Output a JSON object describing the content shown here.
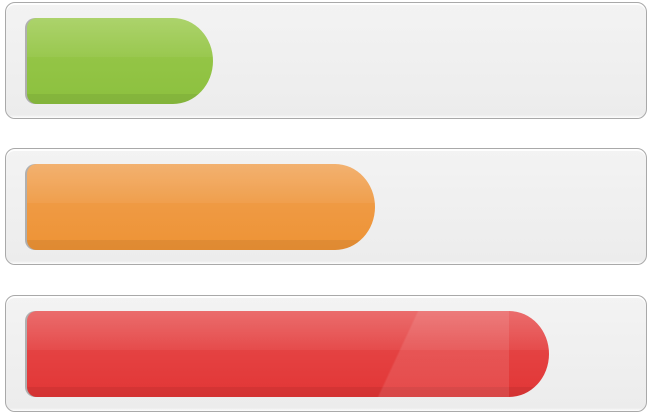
{
  "bars": [
    {
      "id": "bar-1",
      "level": 0.31,
      "color": "#8cc03f"
    },
    {
      "id": "bar-2",
      "level": 0.58,
      "color": "#ee9335"
    },
    {
      "id": "bar-3",
      "level": 0.87,
      "color": "#e23636"
    }
  ]
}
